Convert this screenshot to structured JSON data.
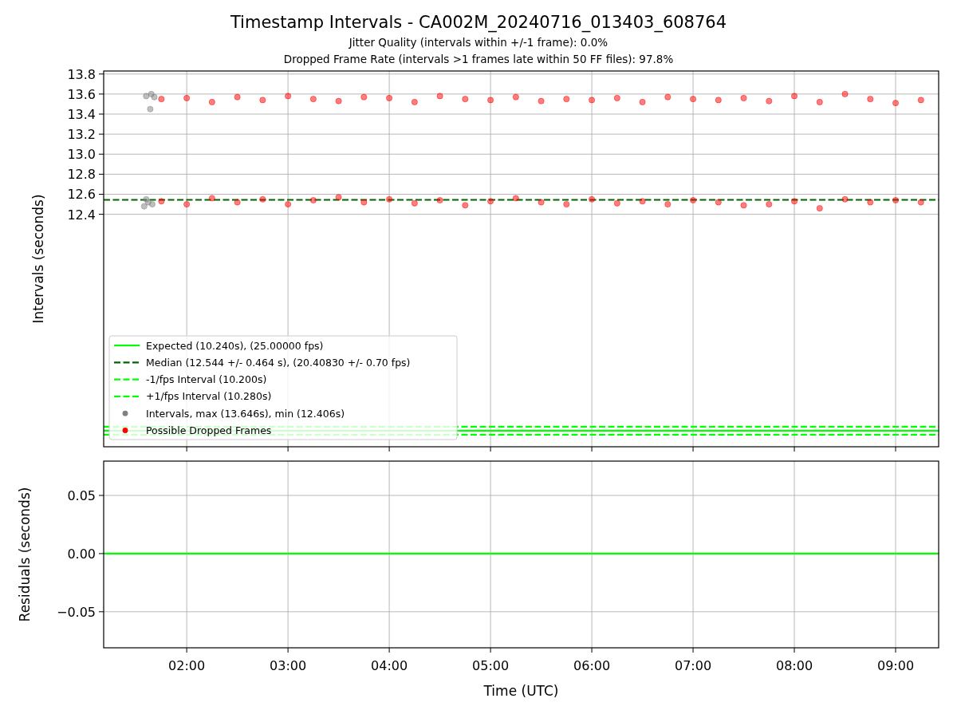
{
  "title": "Timestamp Intervals - CA002M_20240716_013403_608764",
  "subtitles": [
    "Jitter Quality (intervals within +/-1 frame): 0.0%",
    "Dropped Frame Rate (intervals >1 frames late within 50 FF files): 97.8%"
  ],
  "charts": [
    {
      "chart_data": {
        "type": "scatter",
        "ylabel": "Intervals (seconds)",
        "xlim": [
          1.18,
          9.425
        ],
        "ylim": [
          10.08,
          13.83
        ],
        "grid": true,
        "yticks": [
          {
            "value": 12.4,
            "label": "12.4"
          },
          {
            "value": 12.6,
            "label": "12.6"
          },
          {
            "value": 12.8,
            "label": "12.8"
          },
          {
            "value": 13.0,
            "label": "13.0"
          },
          {
            "value": 13.2,
            "label": "13.2"
          },
          {
            "value": 13.4,
            "label": "13.4"
          },
          {
            "value": 13.6,
            "label": "13.6"
          },
          {
            "value": 13.8,
            "label": "13.8"
          }
        ],
        "ref_lines": [
          {
            "axis": "y",
            "value": 10.24,
            "label": "Expected (10.240s), (25.00000 fps)",
            "color": "#00ff00"
          },
          {
            "axis": "y",
            "value": 12.544,
            "label": "Median (12.544 +/- 0.464 s), (20.40830 +/- 0.70 fps)",
            "color": "#006400"
          },
          {
            "axis": "y",
            "value": 10.2,
            "label": "-1/fps Interval (10.200s)",
            "color": "#00ff00"
          },
          {
            "axis": "y",
            "value": 10.28,
            "label": "+1/fps Interval (10.280s)",
            "color": "#00ff00"
          }
        ],
        "legend": "lower left",
        "series": [
          {
            "name": "Intervals, max (13.646s), min (12.406s)",
            "color": "#808080",
            "x": [
              1.58,
              1.6,
              1.62,
              1.64,
              1.66,
              1.68,
              1.6,
              1.65
            ],
            "values": [
              12.48,
              13.58,
              12.52,
              13.45,
              12.5,
              13.57,
              12.55,
              13.6
            ]
          },
          {
            "name": "Possible Dropped Frames",
            "color": "#ff0000",
            "x": [
              1.75,
              1.75,
              2.0,
              2.0,
              2.25,
              2.25,
              2.5,
              2.5,
              2.75,
              2.75,
              3.0,
              3.0,
              3.25,
              3.25,
              3.5,
              3.5,
              3.75,
              3.75,
              4.0,
              4.0,
              4.25,
              4.25,
              4.5,
              4.5,
              4.75,
              4.75,
              5.0,
              5.0,
              5.25,
              5.25,
              5.5,
              5.5,
              5.75,
              5.75,
              6.0,
              6.0,
              6.25,
              6.25,
              6.5,
              6.5,
              6.75,
              6.75,
              7.0,
              7.0,
              7.25,
              7.25,
              7.5,
              7.5,
              7.75,
              7.75,
              8.0,
              8.0,
              8.25,
              8.25,
              8.5,
              8.5,
              8.75,
              8.75,
              9.0,
              9.0,
              9.25,
              9.25
            ],
            "values": [
              12.53,
              13.55,
              12.5,
              13.56,
              12.56,
              13.52,
              12.52,
              13.57,
              12.55,
              13.54,
              12.5,
              13.58,
              12.54,
              13.55,
              12.57,
              13.53,
              12.52,
              13.57,
              12.55,
              13.56,
              12.51,
              13.52,
              12.54,
              13.58,
              12.49,
              13.55,
              12.53,
              13.54,
              12.56,
              13.57,
              12.52,
              13.53,
              12.5,
              13.55,
              12.55,
              13.54,
              12.51,
              13.56,
              12.53,
              13.52,
              12.5,
              13.57,
              12.54,
              13.55,
              12.52,
              13.54,
              12.49,
              13.56,
              12.5,
              13.53,
              12.53,
              13.58,
              12.46,
              13.52,
              12.55,
              13.6,
              12.52,
              13.55,
              12.54,
              13.51,
              12.52,
              13.54
            ]
          }
        ]
      }
    },
    {
      "chart_data": {
        "type": "line",
        "xlabel": "Time (UTC)",
        "ylabel": "Residuals (seconds)",
        "xlim": [
          1.18,
          9.425
        ],
        "ylim": [
          -0.081,
          0.0795
        ],
        "grid": true,
        "xticks": [
          {
            "value": 2,
            "label": "02:00"
          },
          {
            "value": 3,
            "label": "03:00"
          },
          {
            "value": 4,
            "label": "04:00"
          },
          {
            "value": 5,
            "label": "05:00"
          },
          {
            "value": 6,
            "label": "06:00"
          },
          {
            "value": 7,
            "label": "07:00"
          },
          {
            "value": 8,
            "label": "08:00"
          },
          {
            "value": 9,
            "label": "09:00"
          }
        ],
        "yticks": [
          {
            "value": 0.05,
            "label": "0.05"
          },
          {
            "value": 0,
            "label": "0.00"
          },
          {
            "value": -0.05,
            "label": "−0.05"
          }
        ],
        "series": [
          {
            "color": "#00ff00",
            "x": [
              1.18,
              9.425
            ],
            "values": [
              0,
              0
            ]
          }
        ]
      }
    }
  ]
}
